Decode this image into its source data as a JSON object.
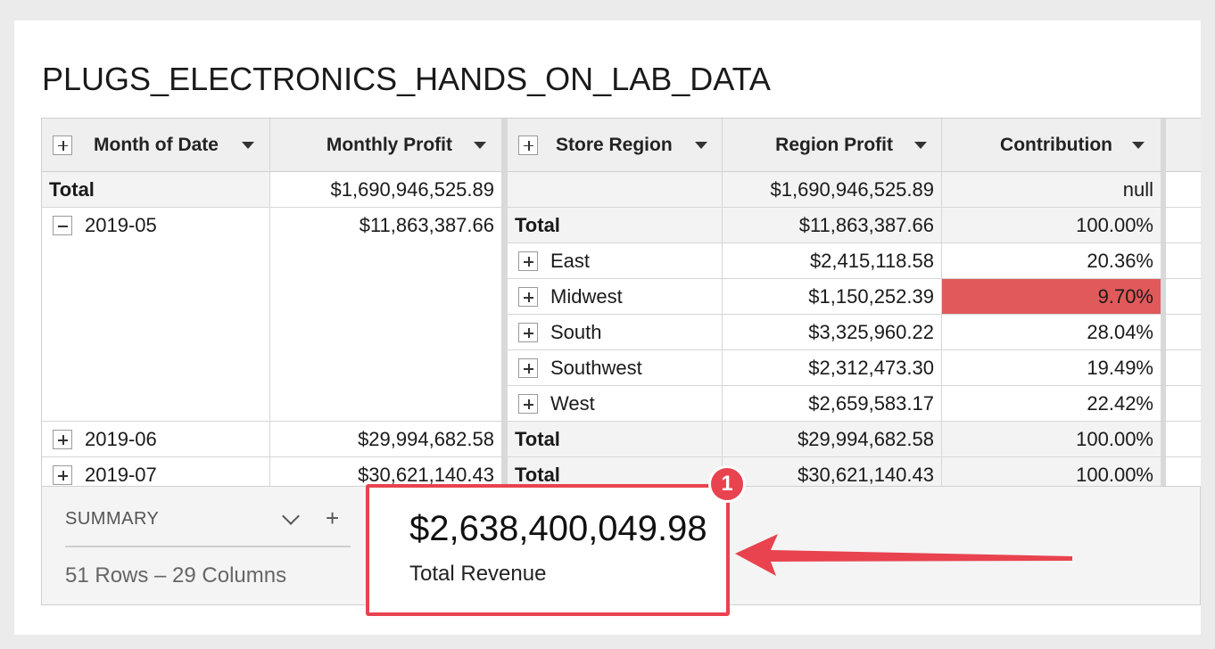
{
  "page": {
    "title": "PLUGS_ELECTRONICS_HANDS_ON_LAB_DATA"
  },
  "table": {
    "columns": {
      "month": "Month of Date",
      "monthly_profit": "Monthly Profit",
      "store_region": "Store Region",
      "region_profit": "Region Profit",
      "contribution": "Contribution"
    },
    "grand_total": {
      "label": "Total",
      "monthly_profit": "$1,690,946,525.89",
      "region_profit": "$1,690,946,525.89",
      "contribution": "null"
    },
    "groups": [
      {
        "month": "2019-05",
        "monthly_profit": "$11,863,387.66",
        "total_label": "Total",
        "total_region_profit": "$11,863,387.66",
        "total_contribution": "100.00%",
        "regions": [
          {
            "name": "East",
            "profit": "$2,415,118.58",
            "contribution": "20.36%"
          },
          {
            "name": "Midwest",
            "profit": "$1,150,252.39",
            "contribution": "9.70%"
          },
          {
            "name": "South",
            "profit": "$3,325,960.22",
            "contribution": "28.04%"
          },
          {
            "name": "Southwest",
            "profit": "$2,312,473.30",
            "contribution": "19.49%"
          },
          {
            "name": "West",
            "profit": "$2,659,583.17",
            "contribution": "22.42%"
          }
        ]
      },
      {
        "month": "2019-06",
        "monthly_profit": "$29,994,682.58",
        "total_label": "Total",
        "total_region_profit": "$29,994,682.58",
        "total_contribution": "100.00%"
      },
      {
        "month": "2019-07",
        "monthly_profit": "$30,621,140.43",
        "total_label": "Total",
        "total_region_profit": "$30,621,140.43",
        "total_contribution": "100.00%"
      }
    ],
    "highlight_color": "#e05a5a"
  },
  "summary": {
    "title": "SUMMARY",
    "counts": "51 Rows – 29 Columns"
  },
  "kpi": {
    "value": "$2,638,400,049.98",
    "label": "Total Revenue",
    "badge": "1",
    "accent": "#e8434f"
  }
}
